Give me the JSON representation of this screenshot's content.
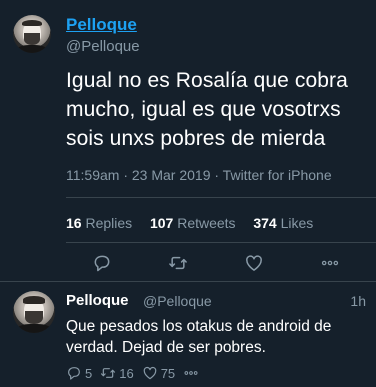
{
  "tweet": {
    "display_name": "Pelloque",
    "handle": "@Pelloque",
    "text": "Igual no es Rosalía que cobra mucho, igual es que vosotrxs sois unxs pobres de mierda",
    "meta": "11:59am · 23 Mar 2019 · Twitter for iPhone",
    "stats": {
      "replies_count": "16",
      "replies_label": "Replies",
      "retweets_count": "107",
      "retweets_label": "Retweets",
      "likes_count": "374",
      "likes_label": "Likes"
    },
    "actions": [
      {
        "icon": "reply-icon"
      },
      {
        "icon": "retweet-icon"
      },
      {
        "icon": "like-icon"
      },
      {
        "icon": "more-icon"
      }
    ]
  },
  "reply": {
    "display_name": "Pelloque",
    "handle": "@Pelloque",
    "time": "1h",
    "text": "Que pesados los otakus de android de verdad. Dejad de ser pobres.",
    "counts": {
      "replies": "5",
      "retweets": "16",
      "likes": "75"
    }
  },
  "colors": {
    "background": "#15202b",
    "accent": "#1da1f2",
    "secondary_text": "#8899a6",
    "divider": "#38444d"
  }
}
